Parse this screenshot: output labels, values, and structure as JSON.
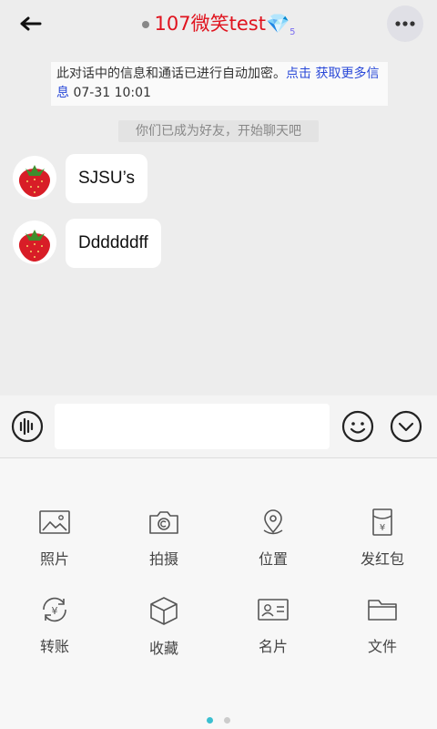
{
  "header": {
    "title": "107微笑test💎",
    "level_badge": "5"
  },
  "notice": {
    "text": "此对话中的信息和通话已进行自动加密。",
    "link": "点击 获取更多信息",
    "time": "07-31 10:01"
  },
  "system_message": "你们已成为好友，开始聊天吧",
  "messages": [
    {
      "text": "SJSU’s"
    },
    {
      "text": "Ddddddff"
    }
  ],
  "input": {
    "value": "",
    "placeholder": ""
  },
  "tools": [
    {
      "label": "照片",
      "icon": "image-icon"
    },
    {
      "label": "拍摄",
      "icon": "camera-icon"
    },
    {
      "label": "位置",
      "icon": "location-icon"
    },
    {
      "label": "发红包",
      "icon": "red-packet-icon"
    },
    {
      "label": "转账",
      "icon": "transfer-icon"
    },
    {
      "label": "收藏",
      "icon": "favorites-box-icon"
    },
    {
      "label": "名片",
      "icon": "contact-card-icon"
    },
    {
      "label": "文件",
      "icon": "folder-icon"
    }
  ],
  "pager": {
    "current": 1,
    "total": 2,
    "active_color": "#3bbfd0"
  }
}
